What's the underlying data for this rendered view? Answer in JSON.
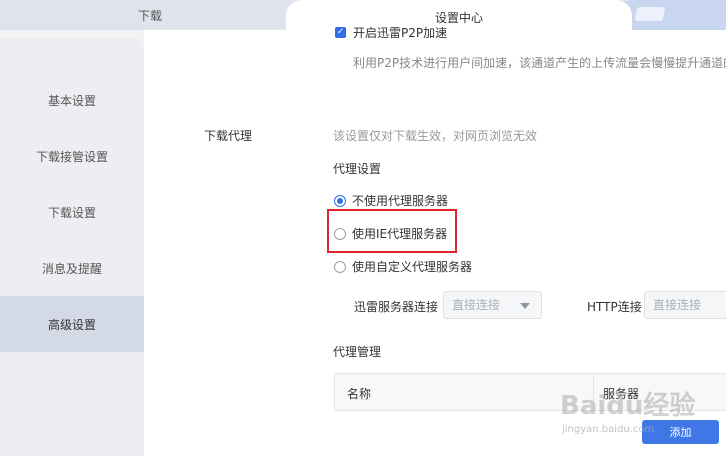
{
  "tabs": {
    "download": "下载",
    "settings_center": "设置中心"
  },
  "sidebar": {
    "items": [
      {
        "label": "基本设置"
      },
      {
        "label": "下载接管设置"
      },
      {
        "label": "下载设置"
      },
      {
        "label": "消息及提醒"
      },
      {
        "label": "高级设置",
        "active": true
      }
    ]
  },
  "p2p": {
    "checkbox_label": "开启迅雷P2P加速",
    "checked": true,
    "description": "利用P2P技术进行用户间加速，该通道产生的上传流量会慢慢提升通道的"
  },
  "proxy": {
    "section_label": "下载代理",
    "note": "该设置仅对下载生效，对网页浏览无效",
    "settings_title": "代理设置",
    "options": [
      {
        "label": "不使用代理服务器",
        "selected": true
      },
      {
        "label": "使用IE代理服务器",
        "selected": false,
        "highlighted": true
      },
      {
        "label": "使用自定义代理服务器",
        "selected": false
      }
    ],
    "xunlei_conn_label": "迅雷服务器连接",
    "xunlei_conn_value": "直接连接",
    "http_conn_label": "HTTP连接",
    "http_conn_value": "直接连接",
    "management_title": "代理管理",
    "table_headers": [
      "名称",
      "服务器"
    ],
    "add_button": "添加"
  },
  "watermark": {
    "main": "Baidu经验",
    "sub": "jingyan.baidu.com"
  },
  "colors": {
    "accent": "#2f6ee8",
    "highlight_box": "#e0262a",
    "sidebar_active": "#d4d9e6"
  }
}
